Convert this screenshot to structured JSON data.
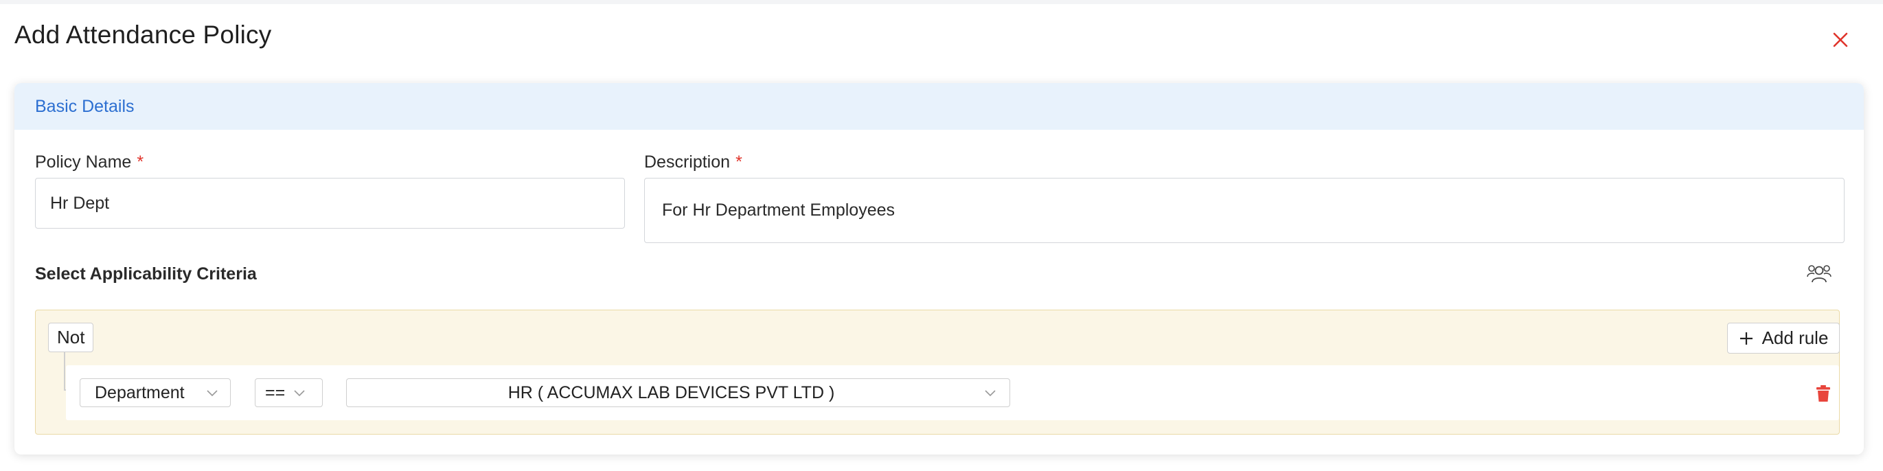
{
  "modal": {
    "title": "Add Attendance Policy"
  },
  "basic_details": {
    "header": "Basic Details",
    "policy_name": {
      "label": "Policy Name",
      "required_mark": "*",
      "value": "Hr Dept"
    },
    "description": {
      "label": "Description",
      "required_mark": "*",
      "value": "For Hr Department Employees"
    }
  },
  "criteria": {
    "title": "Select Applicability Criteria",
    "not_label": "Not",
    "add_rule_label": "Add rule",
    "rule": {
      "field": "Department",
      "operator": "==",
      "value": "HR ( ACCUMAX LAB DEVICES PVT LTD )"
    }
  },
  "colors": {
    "accent": "#2c6fd1",
    "header_bg": "#e8f2fc",
    "required": "#e0342b",
    "group_bg": "#fbf6e6",
    "danger": "#e8453c"
  },
  "icons": {
    "close": "close-icon",
    "group": "users-group-icon",
    "add": "plus-icon",
    "delete": "trash-icon",
    "dropdown": "chevron-down-icon"
  }
}
